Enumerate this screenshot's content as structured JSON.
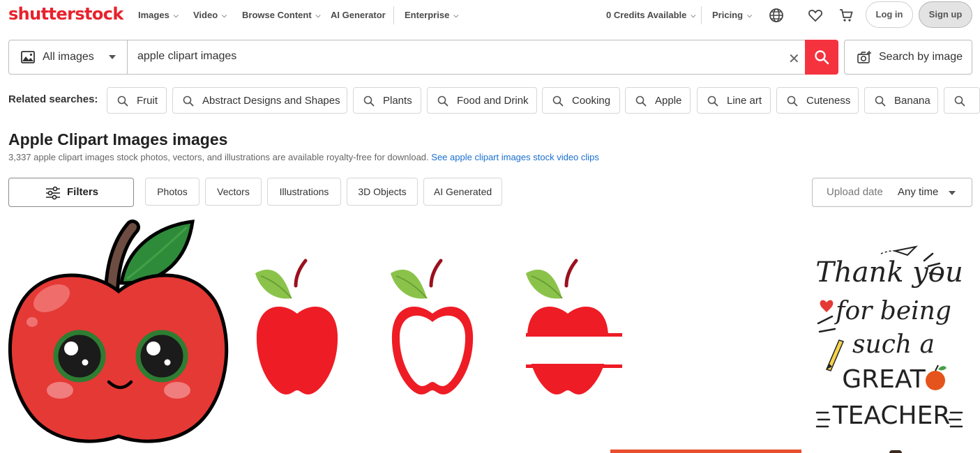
{
  "brand": {
    "logo_text": "shutterstock",
    "accent": "#e8222d"
  },
  "nav": {
    "items": [
      "Images",
      "Video",
      "Browse Content",
      "AI Generator",
      "Enterprise"
    ],
    "credits": "0 Credits Available",
    "pricing": "Pricing",
    "icons": [
      "globe-icon",
      "heart-icon",
      "cart-icon"
    ],
    "login": "Log in",
    "signup": "Sign up"
  },
  "search": {
    "media_type": "All images",
    "query": "apple clipart images",
    "search_by_image": "Search by image"
  },
  "related": {
    "label": "Related searches:",
    "items": [
      "Fruit",
      "Abstract Designs and Shapes",
      "Plants",
      "Food and Drink",
      "Cooking",
      "Apple",
      "Line art",
      "Cuteness",
      "Banana",
      ""
    ]
  },
  "heading": {
    "title": "Apple Clipart Images images",
    "subtitle": "3,337 apple clipart images stock photos, vectors, and illustrations are available royalty-free for download.",
    "video_link": "See apple clipart images stock video clips"
  },
  "filters": {
    "button": "Filters",
    "types": [
      "Photos",
      "Vectors",
      "Illustrations",
      "3D Objects",
      "AI Generated"
    ],
    "upload_date_label": "Upload date",
    "upload_date_value": "Any time"
  },
  "results": {
    "image4_text_lines": [
      "Thank you",
      "for being",
      "such a",
      "GREAT",
      "TEACHER"
    ]
  }
}
